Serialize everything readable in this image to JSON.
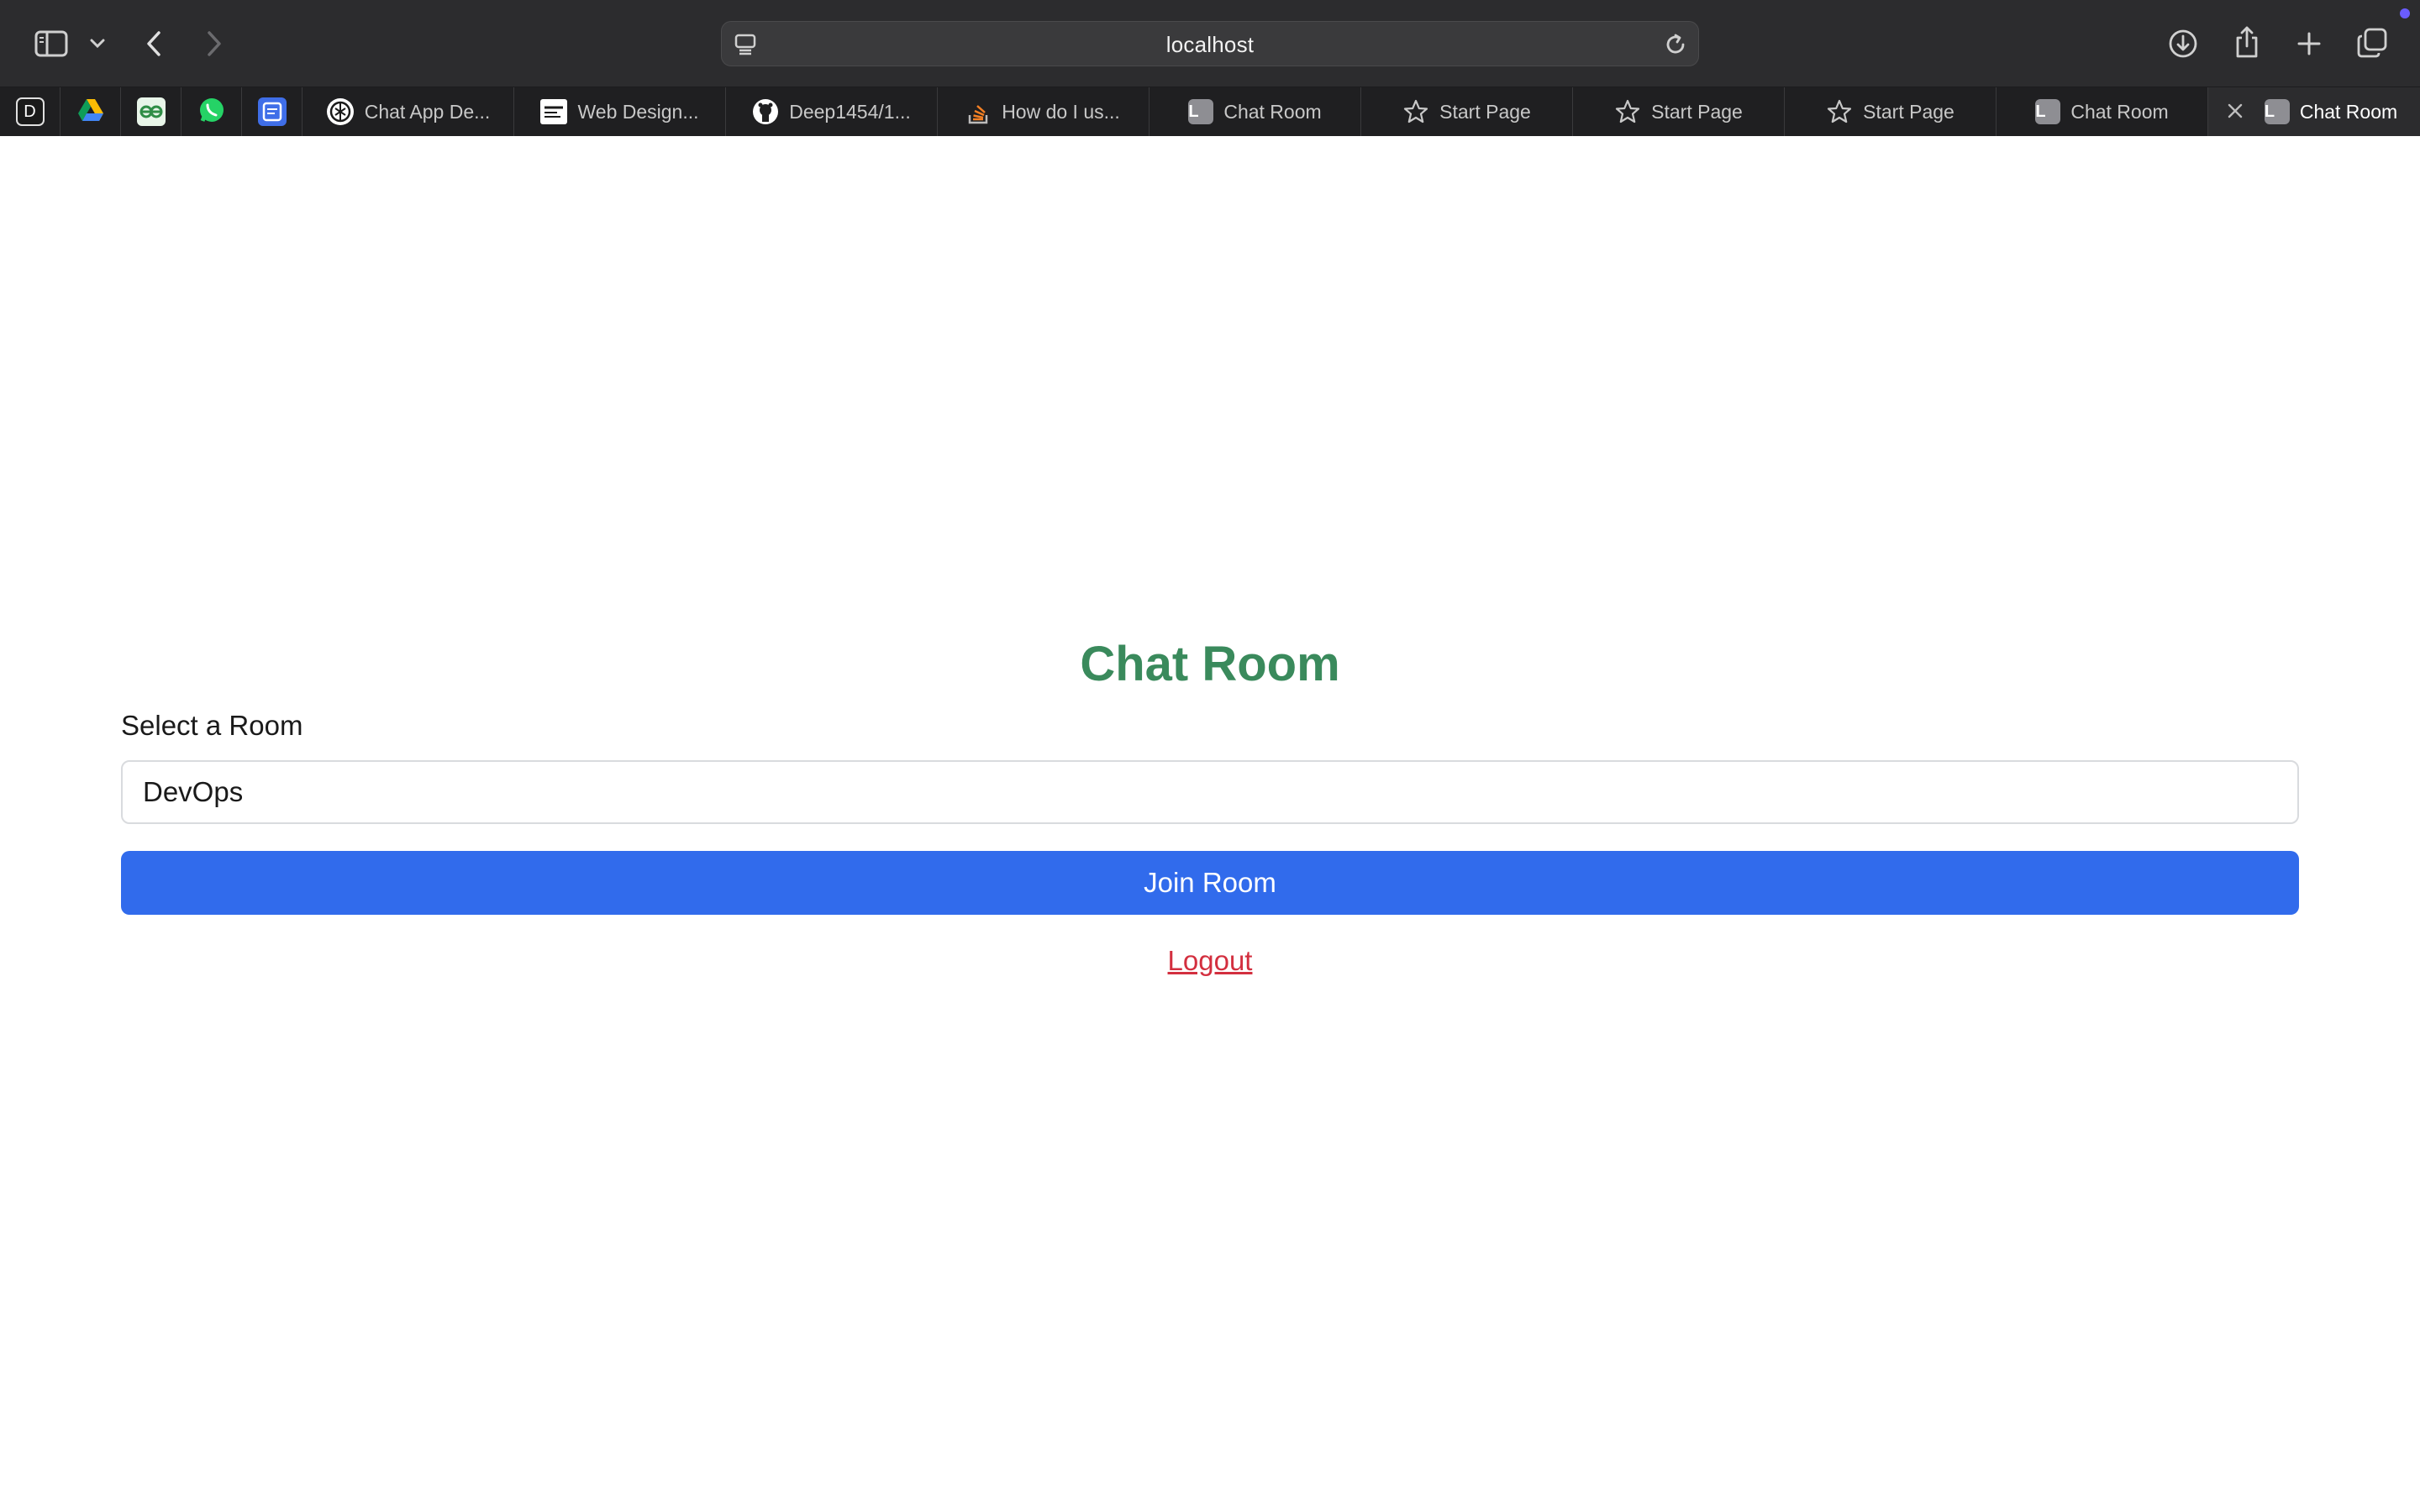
{
  "browser": {
    "url": "localhost",
    "tabs": [
      {
        "title": "Chat App De...",
        "icon": "chatgpt-icon"
      },
      {
        "title": "Web Design...",
        "icon": "web-design-icon"
      },
      {
        "title": "Deep1454/1...",
        "icon": "github-icon"
      },
      {
        "title": "How do I us...",
        "icon": "stackoverflow-icon"
      },
      {
        "title": "Chat Room",
        "icon": "letter-l-icon",
        "letter": "L"
      },
      {
        "title": "Start Page",
        "icon": "star-icon"
      },
      {
        "title": "Start Page",
        "icon": "star-icon"
      },
      {
        "title": "Start Page",
        "icon": "star-icon"
      },
      {
        "title": "Chat Room",
        "icon": "letter-l-icon",
        "letter": "L"
      },
      {
        "title": "Chat Room",
        "icon": "letter-l-icon",
        "letter": "L",
        "active": true
      }
    ],
    "pinned": [
      {
        "icon": "pinned-d-icon",
        "letter": "D"
      },
      {
        "icon": "google-drive-icon"
      },
      {
        "icon": "geeksforgeeks-icon"
      },
      {
        "icon": "whatsapp-icon"
      },
      {
        "icon": "pinned-app-icon"
      }
    ]
  },
  "page": {
    "title": "Chat Room",
    "room_label": "Select a Room",
    "room_selected": "DevOps",
    "join_button": "Join Room",
    "logout_link": "Logout"
  },
  "colors": {
    "title_green": "#3a8a5c",
    "button_blue": "#316bec",
    "logout_red": "#d32f3f"
  }
}
